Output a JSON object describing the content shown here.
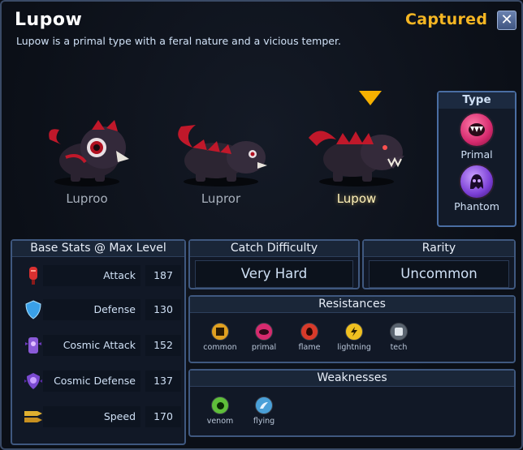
{
  "header": {
    "title": "Lupow",
    "description": "Lupow is a primal type with a feral nature and a vicious temper.",
    "status": "Captured",
    "close_icon": "close-icon"
  },
  "evolutions": [
    {
      "name": "Luproo",
      "current": false
    },
    {
      "name": "Lupror",
      "current": false
    },
    {
      "name": "Lupow",
      "current": true
    }
  ],
  "type_panel": {
    "title": "Type",
    "types": [
      {
        "label": "Primal",
        "icon": "primal-fang-icon",
        "color": "#d62a6e"
      },
      {
        "label": "Phantom",
        "icon": "phantom-ghost-icon",
        "color": "#7b3fd6"
      }
    ]
  },
  "base_stats": {
    "title": "Base Stats @ Max Level",
    "stats": [
      {
        "label": "Attack",
        "value": "187",
        "icon": "attack-icon"
      },
      {
        "label": "Defense",
        "value": "130",
        "icon": "shield-icon"
      },
      {
        "label": "Cosmic Attack",
        "value": "152",
        "icon": "cosmic-attack-icon"
      },
      {
        "label": "Cosmic Defense",
        "value": "137",
        "icon": "cosmic-defense-icon"
      },
      {
        "label": "Speed",
        "value": "170",
        "icon": "speed-icon"
      }
    ]
  },
  "catch_difficulty": {
    "title": "Catch Difficulty",
    "value": "Very Hard"
  },
  "rarity": {
    "title": "Rarity",
    "value": "Uncommon"
  },
  "resistances": {
    "title": "Resistances",
    "items": [
      {
        "label": "common",
        "color": "#e0a020"
      },
      {
        "label": "primal",
        "color": "#d62a6e"
      },
      {
        "label": "flame",
        "color": "#d83a2a"
      },
      {
        "label": "lightning",
        "color": "#f0c020"
      },
      {
        "label": "tech",
        "color": "#5a6470"
      }
    ]
  },
  "weaknesses": {
    "title": "Weaknesses",
    "items": [
      {
        "label": "venom",
        "color": "#5fbf3a"
      },
      {
        "label": "flying",
        "color": "#4aa0d8"
      }
    ]
  }
}
